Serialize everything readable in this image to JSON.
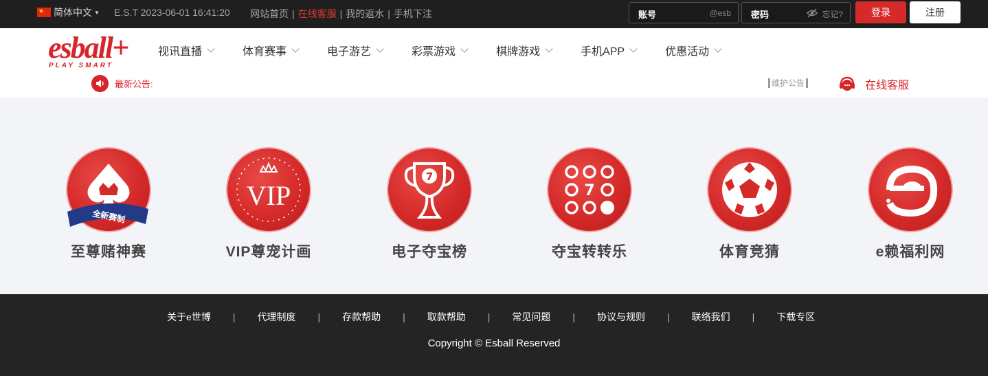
{
  "topbar": {
    "language": "简体中文",
    "clock": "E.S.T 2023-06-01 16:41:20",
    "links": [
      {
        "label": "网站首页",
        "hot": false
      },
      {
        "label": "在线客服",
        "hot": true
      },
      {
        "label": "我的返水",
        "hot": false
      },
      {
        "label": "手机下注",
        "hot": false
      }
    ],
    "account_label": "账号",
    "account_suffix": "@esb",
    "password_label": "密码",
    "forgot_label": "忘记?",
    "login_label": "登录",
    "register_label": "注册"
  },
  "brand": {
    "logo_text": "esball+",
    "logo_sub": "PLAY SMART",
    "color": "#d8242a"
  },
  "nav": {
    "items": [
      "视讯直播",
      "体育赛事",
      "电子游艺",
      "彩票游戏",
      "棋牌游戏",
      "手机APP",
      "优惠活动"
    ]
  },
  "notice": {
    "label": "最新公告:",
    "maintenance": "维护公告",
    "service": "在线客服"
  },
  "features": [
    {
      "name": "至尊赌神赛",
      "icon": "spade-crown-icon",
      "badge": "全新赛制"
    },
    {
      "name": "VIP尊宠计画",
      "icon": "vip-crown-icon",
      "badge": "VIP"
    },
    {
      "name": "电子夺宝榜",
      "icon": "trophy-icon",
      "badge": "7"
    },
    {
      "name": "夺宝转转乐",
      "icon": "slot-dots-icon",
      "badge": "7"
    },
    {
      "name": "体育竞猜",
      "icon": "soccer-ball-icon",
      "badge": ""
    },
    {
      "name": "e赖福利网",
      "icon": "e-logo-icon",
      "badge": ""
    }
  ],
  "footer": {
    "links": [
      "关于e世博",
      "代理制度",
      "存款帮助",
      "取款帮助",
      "常见问题",
      "协议与规则",
      "联络我们",
      "下载专区"
    ],
    "copyright": "Copyright © Esball Reserved"
  }
}
